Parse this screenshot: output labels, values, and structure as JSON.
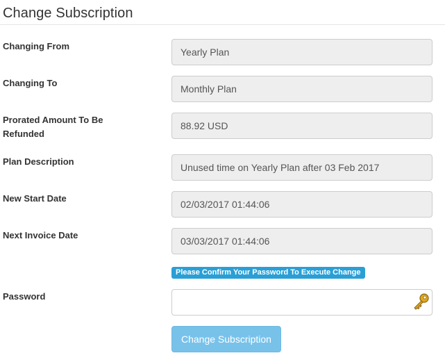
{
  "page": {
    "title": "Change Subscription"
  },
  "rows": {
    "changing_from": {
      "label": "Changing From",
      "value": "Yearly Plan"
    },
    "changing_to": {
      "label": "Changing To",
      "value": "Monthly Plan"
    },
    "prorated_amount": {
      "label": "Prorated Amount To Be Refunded",
      "value": "88.92 USD"
    },
    "plan_description": {
      "label": "Plan Description",
      "value": "Unused time on Yearly Plan after 03 Feb 2017"
    },
    "new_start_date": {
      "label": "New Start Date",
      "value": "02/03/2017 01:44:06"
    },
    "next_invoice_date": {
      "label": "Next Invoice Date",
      "value": "03/03/2017 01:44:06"
    }
  },
  "password": {
    "hint": "Please Confirm Your Password To Execute Change",
    "label": "Password",
    "value": "",
    "icon": "key-icon"
  },
  "actions": {
    "submit_label": "Change Subscription"
  },
  "colors": {
    "accent": "#2a9fd6",
    "button": "#78c2ea",
    "field_bg": "#eeeeee"
  }
}
